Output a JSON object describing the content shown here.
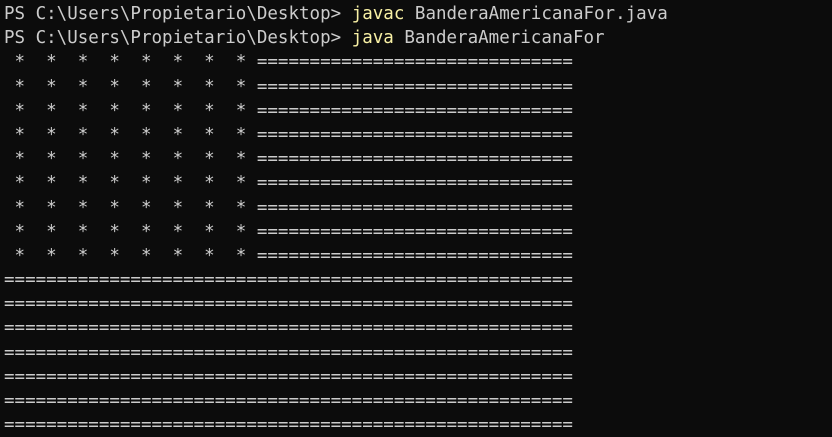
{
  "terminal": {
    "colors": {
      "background": "#0c0c0c",
      "foreground": "#cccccc",
      "command": "#f9f1a5"
    },
    "prompts": [
      {
        "prompt": "PS C:\\Users\\Propietario\\Desktop> ",
        "command": "javac",
        "args": " BanderaAmericanaFor.java"
      },
      {
        "prompt": "PS C:\\Users\\Propietario\\Desktop> ",
        "command": "java",
        "args": " BanderaAmericanaFor"
      }
    ],
    "output": [
      " *  *  *  *  *  *  *  * ==============================",
      " *  *  *  *  *  *  *  * ==============================",
      " *  *  *  *  *  *  *  * ==============================",
      " *  *  *  *  *  *  *  * ==============================",
      " *  *  *  *  *  *  *  * ==============================",
      " *  *  *  *  *  *  *  * ==============================",
      " *  *  *  *  *  *  *  * ==============================",
      " *  *  *  *  *  *  *  * ==============================",
      " *  *  *  *  *  *  *  * ==============================",
      "======================================================",
      "======================================================",
      "======================================================",
      "======================================================",
      "======================================================",
      "======================================================",
      "======================================================"
    ]
  }
}
